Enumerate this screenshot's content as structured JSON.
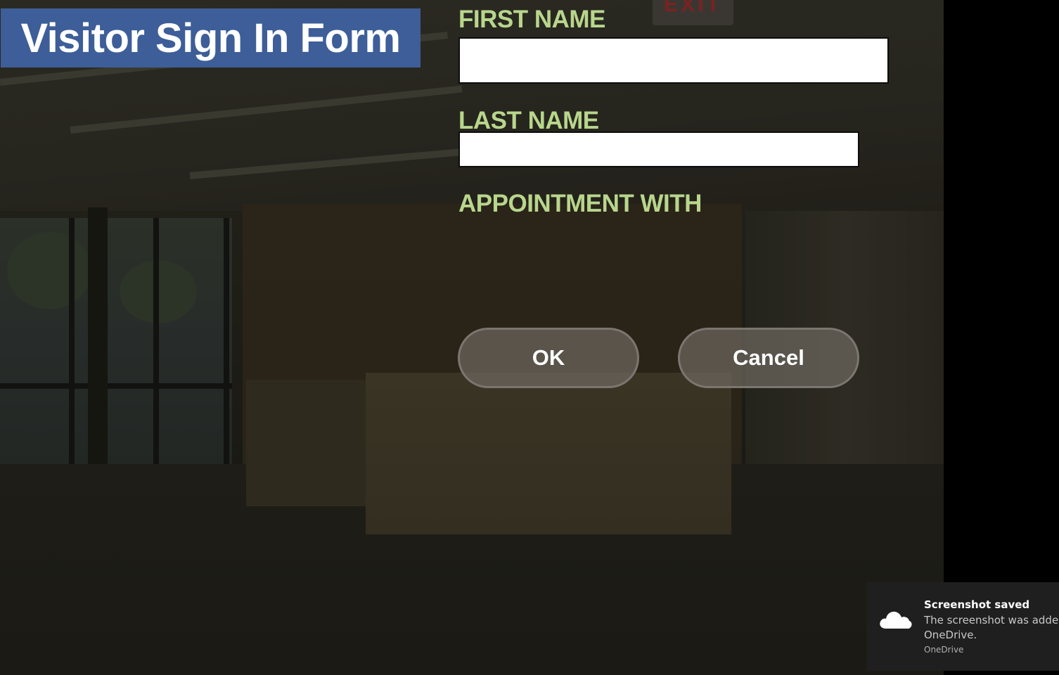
{
  "form": {
    "title": "Visitor Sign In Form",
    "first_name": {
      "label": "FIRST NAME",
      "value": ""
    },
    "last_name": {
      "label": "LAST NAME",
      "value": ""
    },
    "appointment": {
      "label": "APPOINTMENT WITH"
    },
    "ok_label": "OK",
    "cancel_label": "Cancel"
  },
  "notification": {
    "title": "Screenshot saved",
    "body_line1": "The screenshot was added t",
    "body_line2": "OneDrive.",
    "source": "OneDrive",
    "icon": "cloud-icon"
  },
  "colors": {
    "banner": "#3d5e98",
    "label": "#b8d68c",
    "button_fill": "#6e6860"
  }
}
